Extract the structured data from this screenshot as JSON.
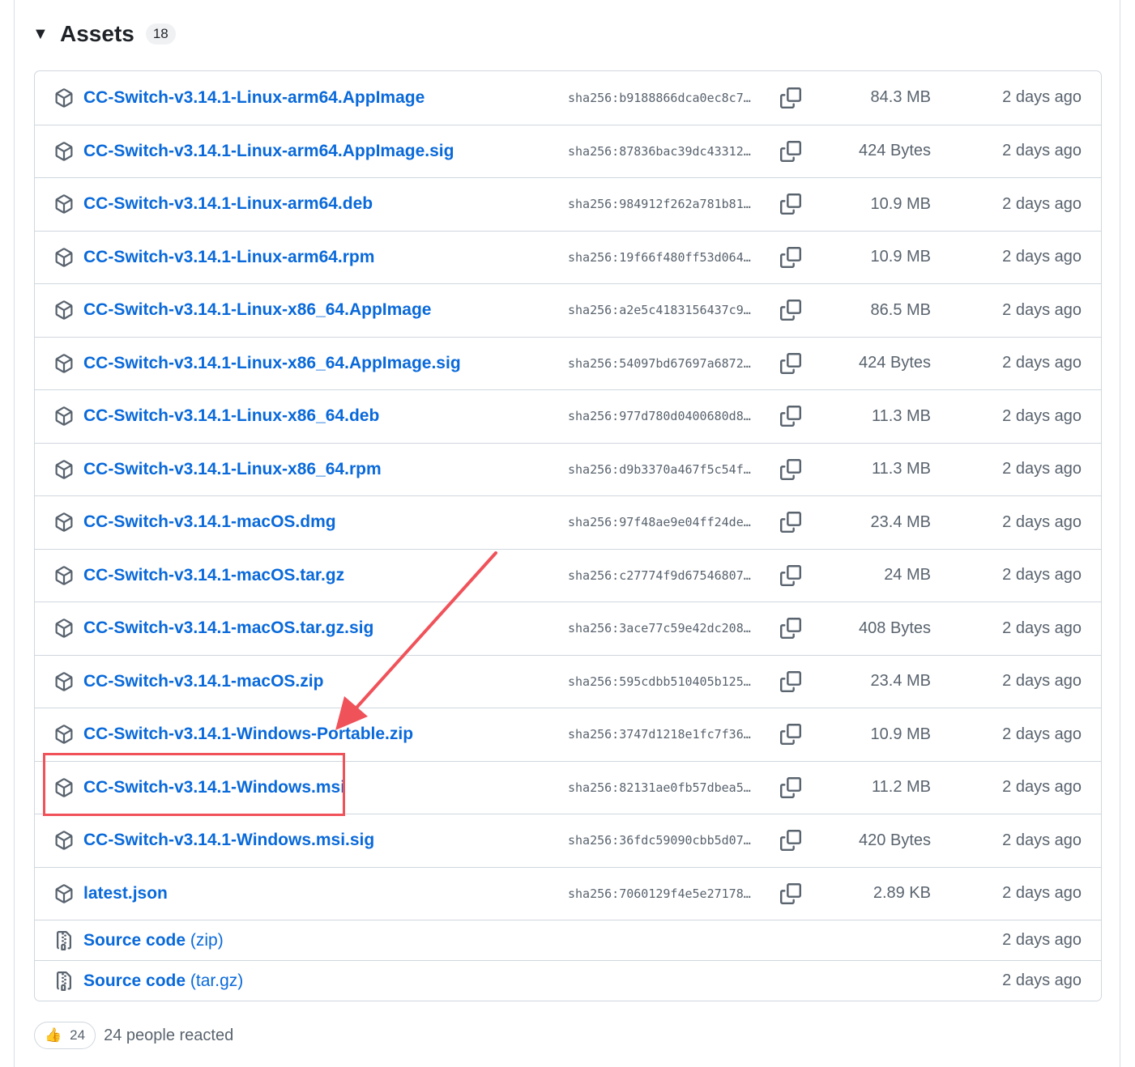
{
  "assets": {
    "title": "Assets",
    "count": "18",
    "items": [
      {
        "name": "CC-Switch-v3.14.1-Linux-arm64.AppImage",
        "sha": "sha256:b9188866dca0ec8c7…",
        "size": "84.3 MB",
        "date": "2 days ago"
      },
      {
        "name": "CC-Switch-v3.14.1-Linux-arm64.AppImage.sig",
        "sha": "sha256:87836bac39dc43312…",
        "size": "424 Bytes",
        "date": "2 days ago"
      },
      {
        "name": "CC-Switch-v3.14.1-Linux-arm64.deb",
        "sha": "sha256:984912f262a781b81…",
        "size": "10.9 MB",
        "date": "2 days ago"
      },
      {
        "name": "CC-Switch-v3.14.1-Linux-arm64.rpm",
        "sha": "sha256:19f66f480ff53d064…",
        "size": "10.9 MB",
        "date": "2 days ago"
      },
      {
        "name": "CC-Switch-v3.14.1-Linux-x86_64.AppImage",
        "sha": "sha256:a2e5c4183156437c9…",
        "size": "86.5 MB",
        "date": "2 days ago"
      },
      {
        "name": "CC-Switch-v3.14.1-Linux-x86_64.AppImage.sig",
        "sha": "sha256:54097bd67697a6872…",
        "size": "424 Bytes",
        "date": "2 days ago"
      },
      {
        "name": "CC-Switch-v3.14.1-Linux-x86_64.deb",
        "sha": "sha256:977d780d0400680d8…",
        "size": "11.3 MB",
        "date": "2 days ago"
      },
      {
        "name": "CC-Switch-v3.14.1-Linux-x86_64.rpm",
        "sha": "sha256:d9b3370a467f5c54f…",
        "size": "11.3 MB",
        "date": "2 days ago"
      },
      {
        "name": "CC-Switch-v3.14.1-macOS.dmg",
        "sha": "sha256:97f48ae9e04ff24de…",
        "size": "23.4 MB",
        "date": "2 days ago"
      },
      {
        "name": "CC-Switch-v3.14.1-macOS.tar.gz",
        "sha": "sha256:c27774f9d67546807…",
        "size": "24 MB",
        "date": "2 days ago"
      },
      {
        "name": "CC-Switch-v3.14.1-macOS.tar.gz.sig",
        "sha": "sha256:3ace77c59e42dc208…",
        "size": "408 Bytes",
        "date": "2 days ago"
      },
      {
        "name": "CC-Switch-v3.14.1-macOS.zip",
        "sha": "sha256:595cdbb510405b125…",
        "size": "23.4 MB",
        "date": "2 days ago"
      },
      {
        "name": "CC-Switch-v3.14.1-Windows-Portable.zip",
        "sha": "sha256:3747d1218e1fc7f36…",
        "size": "10.9 MB",
        "date": "2 days ago"
      },
      {
        "name": "CC-Switch-v3.14.1-Windows.msi",
        "sha": "sha256:82131ae0fb57dbea5…",
        "size": "11.2 MB",
        "date": "2 days ago"
      },
      {
        "name": "CC-Switch-v3.14.1-Windows.msi.sig",
        "sha": "sha256:36fdc59090cbb5d07…",
        "size": "420 Bytes",
        "date": "2 days ago"
      },
      {
        "name": "latest.json",
        "sha": "sha256:7060129f4e5e27178…",
        "size": "2.89 KB",
        "date": "2 days ago"
      }
    ],
    "source_code": [
      {
        "label": "Source code",
        "format": "(zip)",
        "date": "2 days ago"
      },
      {
        "label": "Source code",
        "format": "(tar.gz)",
        "date": "2 days ago"
      }
    ]
  },
  "reactions": {
    "emoji": "👍",
    "count": "24",
    "text": "24 people reacted"
  },
  "colors": {
    "link": "#0969da",
    "muted": "#59636e",
    "border": "#d0d7de",
    "annotation": "#f0525a"
  },
  "icons": {
    "package": "package-icon",
    "copy": "copy-icon",
    "file-zip": "file-zip-icon",
    "caret": "triangle-down-icon"
  }
}
